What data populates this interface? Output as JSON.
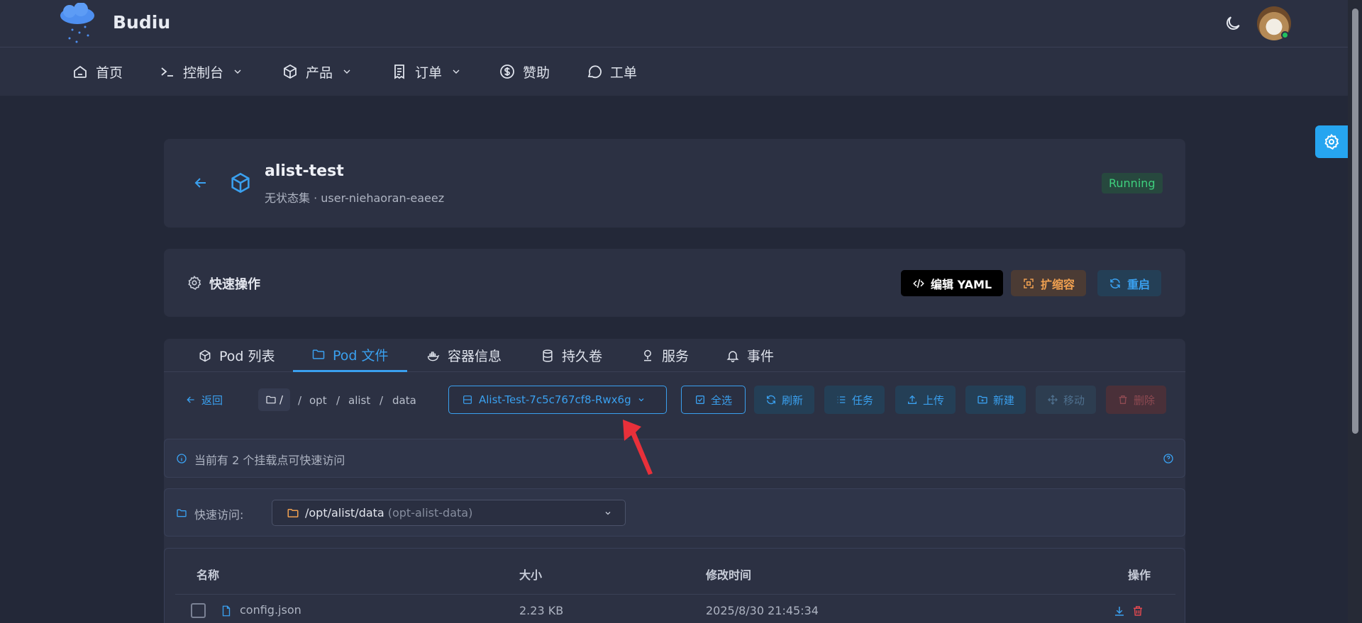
{
  "brand": {
    "name": "Budiu"
  },
  "nav": {
    "home": "首页",
    "console": "控制台",
    "products": "产品",
    "orders": "订单",
    "sponsor": "赞助",
    "tickets": "工单"
  },
  "app": {
    "name": "alist-test",
    "subtitle": "无状态集 · user-niehaoran-eaeez",
    "status": "Running"
  },
  "quick_actions": {
    "title": "快速操作",
    "edit_yaml": "编辑 YAML",
    "scale": "扩缩容",
    "restart": "重启"
  },
  "tabs": {
    "pod_list": "Pod 列表",
    "pod_files": "Pod 文件",
    "container_info": "容器信息",
    "volumes": "持久卷",
    "services": "服务",
    "events": "事件"
  },
  "toolbar": {
    "back": "返回",
    "root": "/",
    "path": [
      "opt",
      "alist",
      "data"
    ],
    "pod_select": "Alist-Test-7c5c767cf8-Rwx6g",
    "select_all": "全选",
    "refresh": "刷新",
    "tasks": "任务",
    "upload": "上传",
    "new": "新建",
    "move": "移动",
    "delete": "删除"
  },
  "info": {
    "text": "当前有 2 个挂载点可快速访问"
  },
  "quick_access": {
    "label": "快速访问:",
    "path": "/opt/alist/data",
    "volume": "(opt-alist-data)"
  },
  "table": {
    "headers": {
      "name": "名称",
      "size": "大小",
      "modified": "修改时间",
      "actions": "操作"
    },
    "rows": [
      {
        "name": "config.json",
        "size": "2.23 KB",
        "modified": "2025/8/30 21:45:34"
      }
    ]
  },
  "colors": {
    "accent": "#3aa0ef",
    "success": "#3ecf7d",
    "warning": "#f0a050",
    "danger": "#e0484f"
  }
}
